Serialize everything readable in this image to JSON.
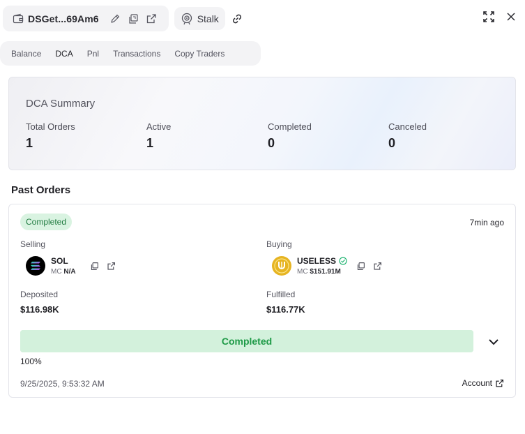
{
  "header": {
    "wallet_name": "DSGet...69Am6",
    "stalk_label": "Stalk"
  },
  "tabs": [
    {
      "label": "Balance"
    },
    {
      "label": "DCA"
    },
    {
      "label": "Pnl"
    },
    {
      "label": "Transactions"
    },
    {
      "label": "Copy Traders"
    }
  ],
  "active_tab": "DCA",
  "summary": {
    "title": "DCA Summary",
    "stats": [
      {
        "label": "Total Orders",
        "value": "1"
      },
      {
        "label": "Active",
        "value": "1"
      },
      {
        "label": "Completed",
        "value": "0"
      },
      {
        "label": "Canceled",
        "value": "0"
      }
    ]
  },
  "past_orders": {
    "title": "Past Orders",
    "order": {
      "status": "Completed",
      "time_ago": "7min ago",
      "selling": {
        "label": "Selling",
        "symbol": "SOL",
        "mc_label": "MC",
        "mc_value": "N/A",
        "icon": "solana-logo"
      },
      "buying": {
        "label": "Buying",
        "symbol": "USELESS",
        "verified": true,
        "mc_label": "MC",
        "mc_value": "$151.91M",
        "icon": "useless-logo"
      },
      "deposited": {
        "label": "Deposited",
        "value": "$116.98K"
      },
      "fulfilled": {
        "label": "Fulfilled",
        "value": "$116.77K"
      },
      "progress_label": "Completed",
      "progress_percent": "100%",
      "progress_fraction": 1.0,
      "date": "9/25/2025, 9:53:32 AM",
      "account_label": "Account"
    }
  },
  "colors": {
    "badge_bg": "#d9f3e1",
    "badge_text": "#1f7a3f",
    "progress_bg": "#d3f1dc",
    "progress_text": "#1e9a47",
    "verified": "#22b573",
    "useless_gold": "#e6b422"
  }
}
